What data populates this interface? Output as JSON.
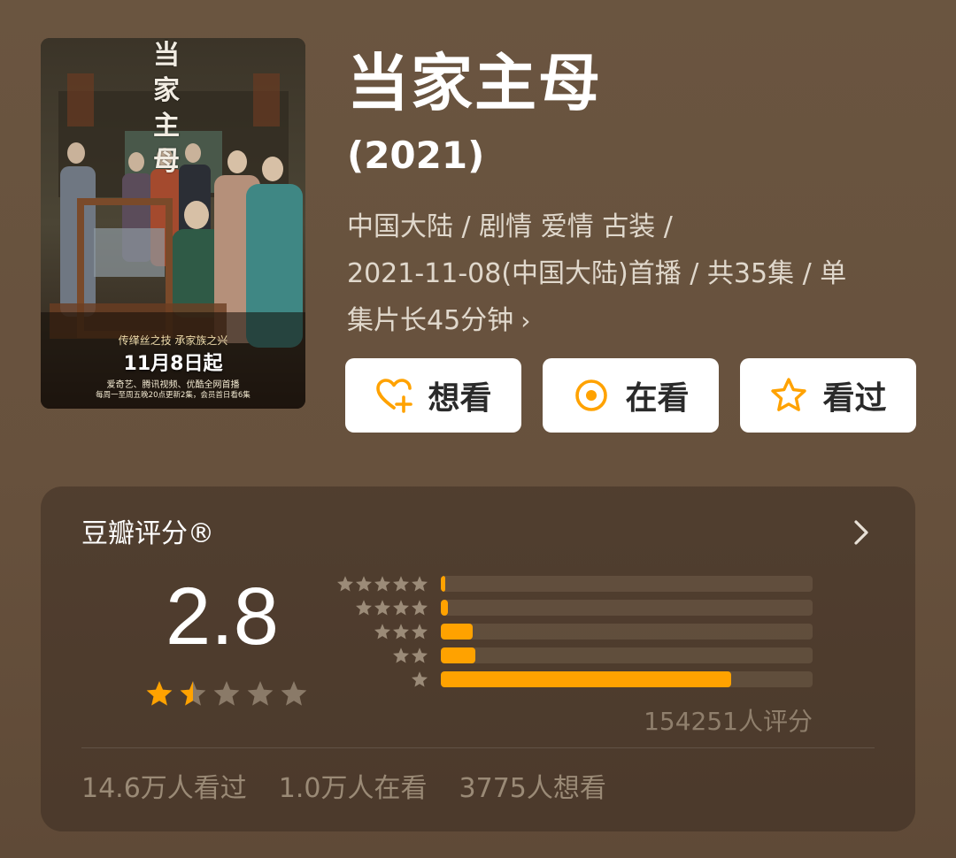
{
  "poster": {
    "title": "当家主母",
    "tagline": "传缂丝之技  承家族之兴",
    "date": "11月8日起",
    "line1": "爱奇艺、腾讯视频、优酷全网首播",
    "line2": "每周一至周五晚20点更新2集，会员首日看6集"
  },
  "header": {
    "title": "当家主母",
    "year": "(2021)",
    "meta_line1": "中国大陆 / 剧情 爱情 古装 /",
    "meta_line2": "2021-11-08(中国大陆)首播 / 共35集 / 单",
    "meta_line3": "集片长45分钟",
    "meta_chevron": "›"
  },
  "buttons": {
    "want": {
      "label": "想看",
      "icon": "heart-plus-icon"
    },
    "watching": {
      "label": "在看",
      "icon": "target-circle-icon"
    },
    "watched": {
      "label": "看过",
      "icon": "star-outline-icon"
    }
  },
  "rating": {
    "title": "豆瓣评分®",
    "score": "2.8",
    "score_stars": 1.5,
    "distribution": [
      {
        "stars": 5,
        "fraction": 0.01
      },
      {
        "stars": 4,
        "fraction": 0.02
      },
      {
        "stars": 3,
        "fraction": 0.085
      },
      {
        "stars": 2,
        "fraction": 0.093
      },
      {
        "stars": 1,
        "fraction": 0.78
      }
    ],
    "count_text": "154251人评分",
    "stats": {
      "watched": "14.6万人看过",
      "watching": "1.0万人在看",
      "want": "3775人想看"
    }
  },
  "colors": {
    "accent": "#ffa200",
    "background": "#6b5540",
    "card": "#4f3e2f"
  }
}
